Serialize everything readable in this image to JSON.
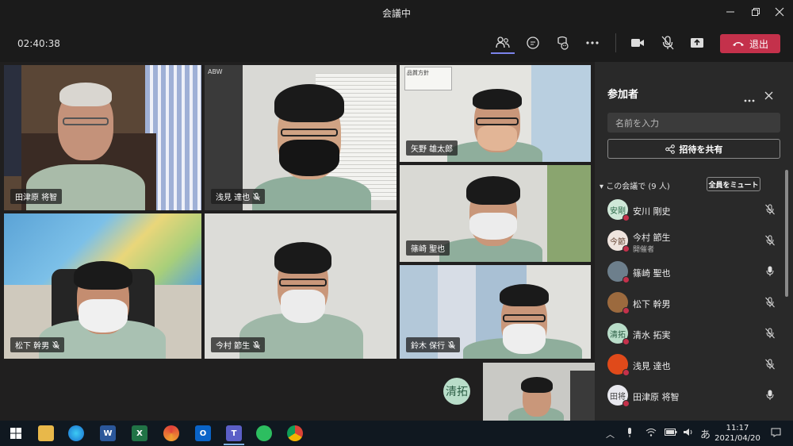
{
  "window": {
    "title": "会議中"
  },
  "meeting": {
    "timer": "02:40:38",
    "leave_label": "退出"
  },
  "tiles": [
    {
      "name": "田津原 将智",
      "muted": false
    },
    {
      "name": "浅見 達也",
      "muted": true
    },
    {
      "name": "矢野 雄太郎",
      "muted": false
    },
    {
      "name": "篠崎 聖也",
      "muted": false
    },
    {
      "name": "松下 幹男",
      "muted": true
    },
    {
      "name": "今村 節生",
      "muted": true
    },
    {
      "name": "鈴木 保行",
      "muted": true
    }
  ],
  "self_avatar": "清拓",
  "tile_signs": {
    "abw": "ABW",
    "safety": "品質方針"
  },
  "panel": {
    "title": "参加者",
    "search_placeholder": "名前を入力",
    "invite_label": "招待を共有",
    "section_label": "この会議で (9 人)",
    "mute_all_label": "全員をミュート",
    "participants": [
      {
        "name": "安川 剛史",
        "initials": "安剛",
        "role": "",
        "muted": true,
        "avatar_color": "#cfe8d8",
        "text_color": "#2d6a4a"
      },
      {
        "name": "今村 節生",
        "initials": "今節",
        "role": "開催者",
        "muted": true,
        "avatar_color": "#efe4de",
        "text_color": "#6a4a3a"
      },
      {
        "name": "篠崎 聖也",
        "initials": "",
        "role": "",
        "muted": false,
        "avatar_color": "#6d7f8c",
        "text_color": "#ffffff"
      },
      {
        "name": "松下 幹男",
        "initials": "",
        "role": "",
        "muted": true,
        "avatar_color": "#9c6a3e",
        "text_color": "#ffffff"
      },
      {
        "name": "清水 拓実",
        "initials": "清拓",
        "role": "",
        "muted": true,
        "avatar_color": "#b9ddc9",
        "text_color": "#2d5f46"
      },
      {
        "name": "浅見 達也",
        "initials": "",
        "role": "",
        "muted": true,
        "avatar_color": "#e04a1a",
        "text_color": "#ffffff"
      },
      {
        "name": "田津原 将智",
        "initials": "田将",
        "role": "",
        "muted": false,
        "avatar_color": "#e8e8ee",
        "text_color": "#444444"
      }
    ]
  },
  "taskbar": {
    "time": "11:17",
    "date": "2021/04/20",
    "ime": "あ"
  }
}
